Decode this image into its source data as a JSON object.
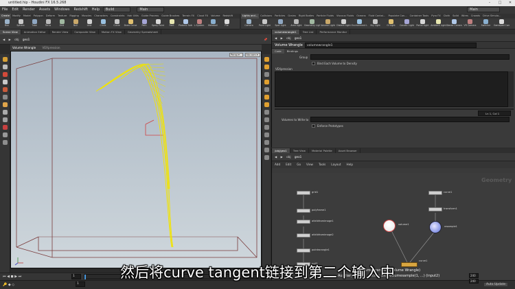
{
  "window": {
    "title": "untitled.hip - Houdini FX 16.5.268"
  },
  "menubar": {
    "items": [
      "File",
      "Edit",
      "Render",
      "Assets",
      "Windows",
      "Redshift",
      "Help"
    ],
    "desktop": "Build",
    "scene": "Main",
    "right_label": "Main"
  },
  "shelf_left": {
    "tabs": [
      "Create",
      "Modify",
      "Model",
      "Polygon",
      "Deform",
      "Texture",
      "Rigging",
      "Muscles",
      "Characters",
      "Constraints",
      "Hair Utils",
      "Guide Process",
      "Guide Brushes",
      "Terrain FX",
      "Cloud FX",
      "Volume",
      "Redshift"
    ],
    "tools": [
      "Box",
      "Sphere",
      "Tube",
      "Torus",
      "Grid",
      "Null",
      "Line",
      "Circle",
      "Curve",
      "Draw Curve",
      "Path",
      "Spray Paint",
      "Font",
      "Platonic Solids",
      "L-System",
      "Metaball",
      "File"
    ]
  },
  "shelf_right": {
    "tabs": [
      "Lights and...",
      "Collisions",
      "Particles",
      "Grains",
      "Rigid Bodies",
      "Particle Fluids",
      "Viscous Fluids",
      "Oceans",
      "Fluid Contai...",
      "Populate Con...",
      "Container Tools",
      "Pyro FX",
      "Cloth",
      "Solid",
      "Wires",
      "Crowds",
      "Drive Simula..."
    ],
    "tools": [
      "Camera",
      "Point Light",
      "Spot Light",
      "Area Light",
      "Geometry Light",
      "Volume Light",
      "Distant Light",
      "Environment Light",
      "Sky Light",
      "GI Light",
      "Caustic Light",
      "Portal Light",
      "Ambient Light",
      "Stereo Camera",
      "VR Camera",
      "Switcher",
      "Gamepad Camera"
    ]
  },
  "left_pane": {
    "tabs": [
      "Scene View",
      "Animation Editor",
      "Render View",
      "Composite View",
      "Motion FX View",
      "Geometry Spreadsheet"
    ],
    "path": [
      "obj",
      "geo1"
    ],
    "viewport_node": "Volume Wrangle",
    "viewport_sub": "VEXpression",
    "persp": "Persp",
    "cam": "No cam"
  },
  "parm_pane": {
    "tabs": [
      "volumewrangle1",
      "Tree List",
      "Performance Monitor"
    ],
    "path": [
      "obj",
      "geo1"
    ],
    "node_type": "Volume Wrangle",
    "node_name": "volumewrangle1",
    "subtabs": [
      "Code",
      "Bindings"
    ],
    "group_label": "Group",
    "bind_each_label": "Bind Each Volume to Density",
    "vex_label": "VEXpression",
    "line_col": "Ln 1, Col 1",
    "volumes_to_write": "Volumes to Write to",
    "enforce_label": "Enforce Prototypes"
  },
  "net_pane": {
    "tabs": [
      "/obj/geo1",
      "Tree View",
      "Material Palette",
      "Asset Browser"
    ],
    "path": [
      "obj",
      "geo1"
    ],
    "menu": [
      "Add",
      "Edit",
      "Go",
      "View",
      "Tools",
      "Layout",
      "Help"
    ],
    "watermark": "Geometry",
    "nodes_left": [
      "grid1",
      "polyframe1",
      "attribfromimage1",
      "attribfromimage2",
      "pointwrangle1",
      "null1"
    ],
    "nodes_right": [
      "curve1",
      "transform1",
      "resample1"
    ],
    "volume_node": "volume1",
    "wrangle_node": "volumewrangle1 (Volume Wrangle)",
    "wrangle_tip": "Auxiliary Input 1, access with volumesample(1, ...) (input2)",
    "merge_label": "curve1"
  },
  "timeline": {
    "frame": "1",
    "start": "1",
    "end": "240",
    "end2": "240",
    "marks": [
      "24",
      "48",
      "72",
      "96",
      "120",
      "144",
      "168",
      "192",
      "216",
      "240"
    ]
  },
  "status": {
    "auto_update": "Auto Update"
  },
  "subtitle": "然后将curve tangent链接到第二个输入中"
}
